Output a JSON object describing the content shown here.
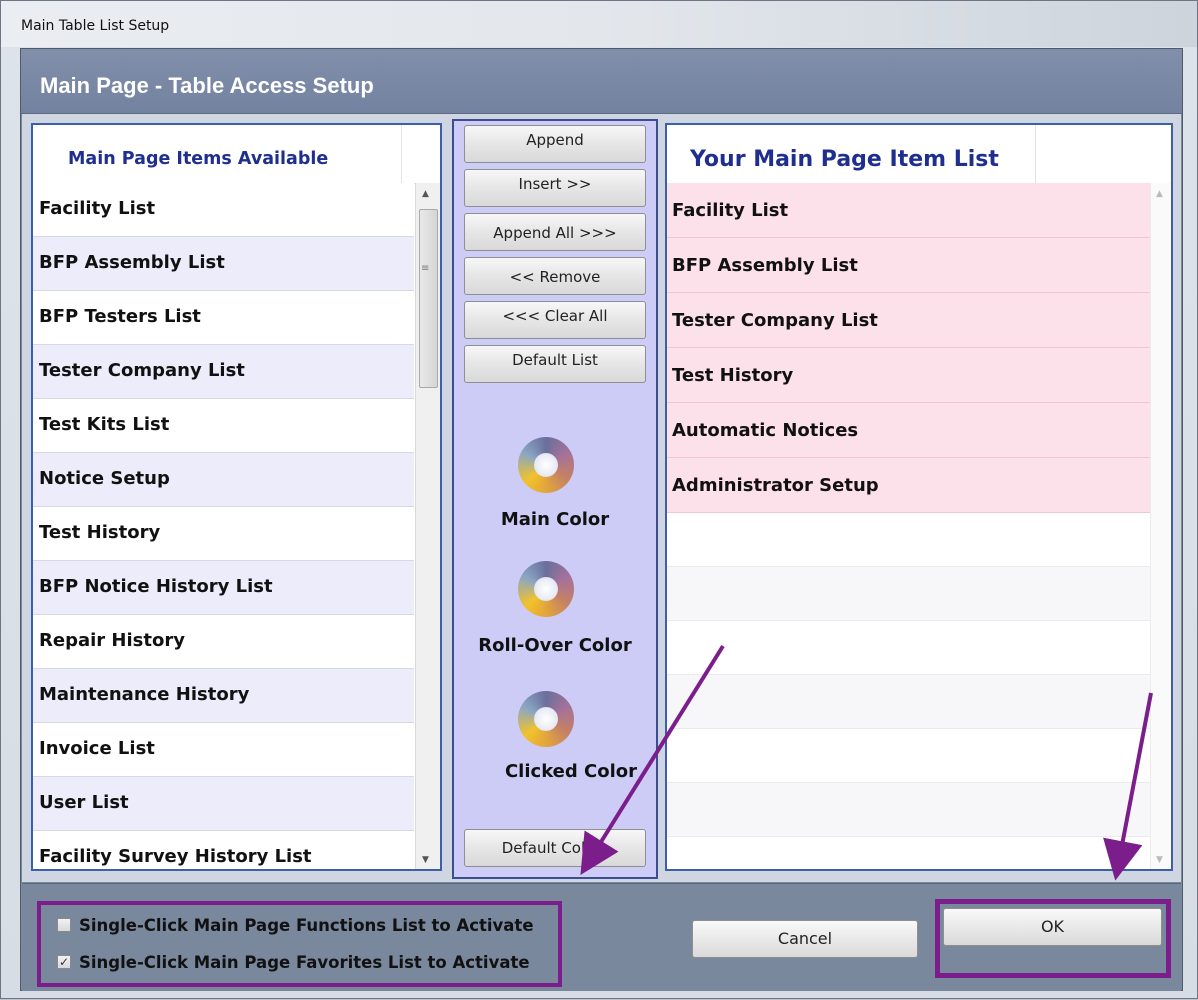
{
  "window": {
    "title": "Main Table List Setup"
  },
  "header": {
    "title": "Main Page - Table Access Setup"
  },
  "available": {
    "heading": "Main Page Items Available",
    "items": [
      "Facility List",
      "BFP Assembly List",
      "BFP Testers List",
      "Tester Company List",
      "Test Kits List",
      "Notice Setup",
      "Test History",
      "BFP Notice History List",
      "Repair History",
      "Maintenance History",
      "Invoice List",
      "User List",
      "Facility Survey History List"
    ]
  },
  "actions": {
    "append": "Append",
    "insert": "Insert >>",
    "append_all": "Append All >>>",
    "remove": "<< Remove",
    "clear_all": "<<< Clear All",
    "default_list": "Default List",
    "default_colors": "Default Colors"
  },
  "colors": {
    "main": "Main Color",
    "rollover": "Roll-Over Color",
    "clicked": "Clicked Color"
  },
  "selected": {
    "heading": "Your Main Page Item List",
    "items": [
      "Facility List",
      "BFP Assembly List",
      "Tester Company List",
      "Test History",
      "Automatic Notices",
      "Administrator Setup"
    ]
  },
  "options": {
    "functions_label": "Single-Click Main Page Functions List to Activate",
    "functions_checked": false,
    "favorites_label": "Single-Click Main Page Favorites List to Activate",
    "favorites_checked": true
  },
  "buttons": {
    "cancel": "Cancel",
    "ok": "OK"
  },
  "theme": {
    "header_bg": "#7382a0",
    "accent_text": "#1f2f8f",
    "selected_row_bg": "#fde1ea",
    "annotation": "#7b1e8c"
  }
}
